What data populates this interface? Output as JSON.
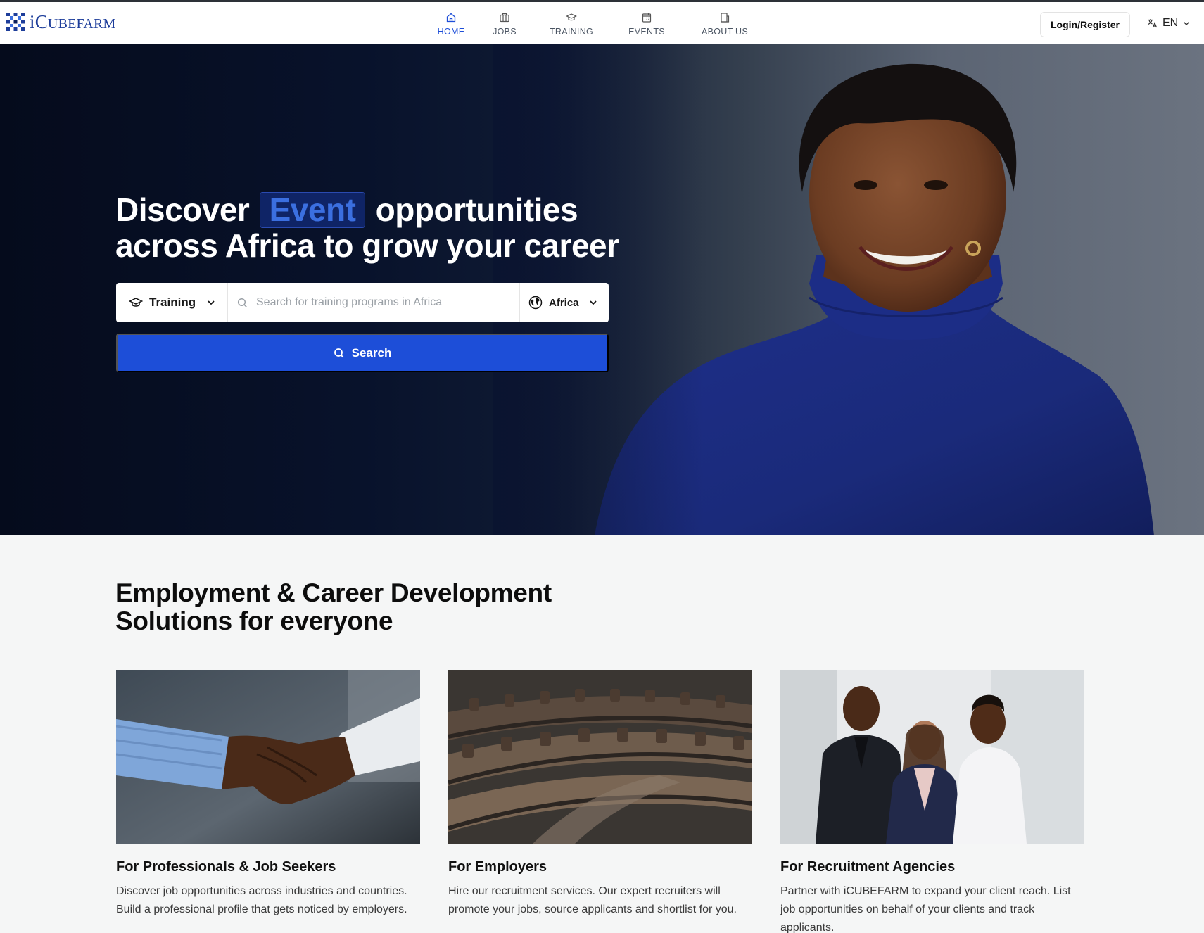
{
  "brand": {
    "name": "iCubefarm",
    "name_parts": [
      "i",
      "C",
      "UBEFARM"
    ]
  },
  "nav": {
    "items": [
      {
        "label": "HOME",
        "icon": "home-icon",
        "active": true
      },
      {
        "label": "JOBS",
        "icon": "briefcase-icon",
        "active": false
      },
      {
        "label": "TRAINING",
        "icon": "graduation-cap-icon",
        "active": false
      },
      {
        "label": "EVENTS",
        "icon": "calendar-icon",
        "active": false
      },
      {
        "label": "ABOUT US",
        "icon": "building-icon",
        "active": false
      }
    ],
    "login_label": "Login/Register",
    "language": "EN"
  },
  "hero": {
    "title_prefix": "Discover",
    "title_highlight": "Event",
    "title_line1_suffix": "opportunities",
    "title_line2": "across Africa to grow your career",
    "search": {
      "type_label": "Training",
      "placeholder": "Search for training programs in Africa",
      "region_label": "Africa",
      "button_label": "Search"
    }
  },
  "solutions": {
    "title_line1": "Employment & Career Development",
    "title_line2": "Solutions for everyone",
    "cards": [
      {
        "title": "For Professionals & Job Seekers",
        "text": "Discover job opportunities across industries and countries. Build a professional profile that gets noticed by employers."
      },
      {
        "title": "For Employers",
        "text": "Hire our recruitment services. Our expert recruiters will promote your jobs, source applicants and shortlist for you."
      },
      {
        "title": "For Recruitment Agencies",
        "text": "Partner with iCUBEFARM to expand your client reach. List job opportunities on behalf of your clients and track applicants."
      }
    ]
  },
  "colors": {
    "accent": "#1d4ed8",
    "brand": "#1d3d9a",
    "hero_dark": "#050b1c"
  }
}
